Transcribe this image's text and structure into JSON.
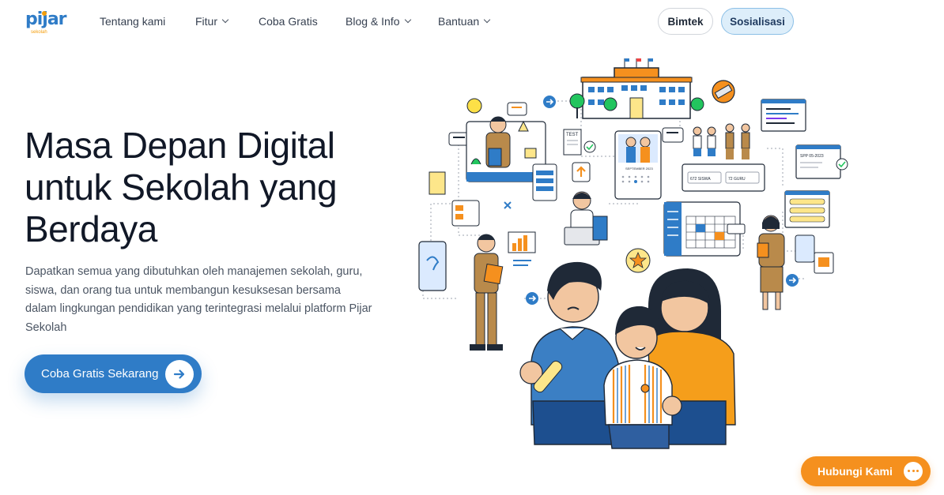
{
  "nav": {
    "logo": {
      "word": "pijar",
      "sub": "sekolah"
    },
    "items": [
      {
        "label": "Tentang kami",
        "has_dropdown": false
      },
      {
        "label": "Fitur",
        "has_dropdown": true
      },
      {
        "label": "Coba Gratis",
        "has_dropdown": false
      },
      {
        "label": "Blog & Info",
        "has_dropdown": true
      },
      {
        "label": "Bantuan",
        "has_dropdown": true
      }
    ],
    "bimtek_label": "Bimtek",
    "sosialisasi_label": "Sosialisasi"
  },
  "hero": {
    "title": "Masa Depan Digital untuk Sekolah yang Berdaya",
    "description": "Dapatkan semua yang dibutuhkan oleh manajemen sekolah, guru, siswa, dan orang tua untuk membangun kesuksesan bersama dalam lingkungan pendidikan yang terintegrasi melalui platform Pijar Sekolah",
    "cta_label": "Coba Gratis Sekarang"
  },
  "illustration": {
    "test_label": "TEST",
    "calendar_label": "SEPTEMBER 2023",
    "stat_students": "672 SISWA",
    "stat_teachers": "72 GURU",
    "spp_label": "SPP 05-2023"
  },
  "contact": {
    "label": "Hubungi Kami"
  },
  "colors": {
    "primary": "#2f7cc7",
    "accent": "#f5901e",
    "text": "#111827"
  }
}
